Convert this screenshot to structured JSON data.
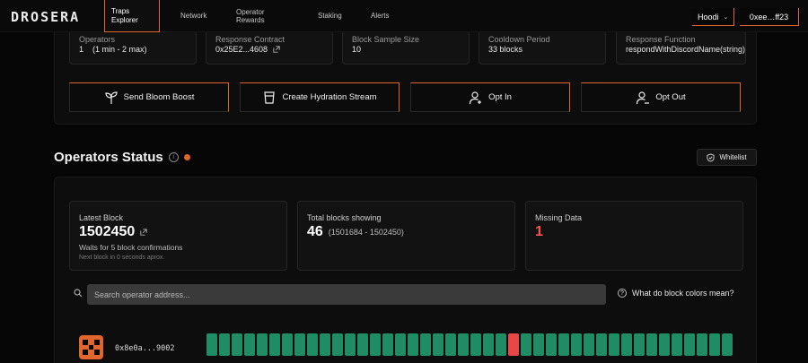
{
  "nav": {
    "logo": "DROSERA",
    "tabs": [
      {
        "label_1": "Traps",
        "label_2": "Explorer"
      },
      {
        "label_1": "Network"
      },
      {
        "label_1": "Operator",
        "label_2": "Rewards"
      },
      {
        "label_1": "Staking"
      },
      {
        "label_1": "Alerts"
      }
    ],
    "network": "Hoodi",
    "wallet": "0xee…ff23"
  },
  "trap_info": [
    {
      "label": "Operators",
      "value": "1",
      "extra": "(1 min - 2 max)"
    },
    {
      "label": "Response Contract",
      "value": "0x25E2...4608"
    },
    {
      "label": "Block Sample Size",
      "value": "10"
    },
    {
      "label": "Cooldown Period",
      "value": "33 blocks"
    },
    {
      "label": "Response Function",
      "value": "respondWithDiscordName(string)"
    }
  ],
  "actions": {
    "bloom": "Send Bloom Boost",
    "hydration": "Create Hydration Stream",
    "opt_in": "Opt In",
    "opt_out": "Opt Out"
  },
  "status": {
    "title": "Operators Status",
    "whitelist": "Whitelist",
    "latest_block": {
      "label": "Latest Block",
      "value": "1502450",
      "note": "Waits for 5 block confirmations",
      "sub": "Next block in 0 seconds aprox."
    },
    "total_blocks": {
      "label": "Total blocks showing",
      "value": "46",
      "range": "(1501684 - 1502450)"
    },
    "missing": {
      "label": "Missing Data",
      "value": "1"
    }
  },
  "search": {
    "placeholder": "Search operator address..."
  },
  "help": {
    "label": "What do block colors mean?"
  },
  "operators": [
    {
      "address": "0x8e0a...9002",
      "blocks": [
        1,
        1,
        1,
        1,
        1,
        1,
        1,
        1,
        1,
        1,
        1,
        1,
        1,
        1,
        1,
        1,
        1,
        1,
        1,
        1,
        1,
        1,
        1,
        1,
        0,
        1,
        1,
        1,
        1,
        1,
        1,
        1,
        1,
        1,
        1,
        1,
        1,
        1,
        1,
        1,
        1,
        1
      ]
    }
  ],
  "colors": {
    "accent": "#e0662b",
    "ok_block": "#1f8c66",
    "missing_block": "#e74747"
  }
}
